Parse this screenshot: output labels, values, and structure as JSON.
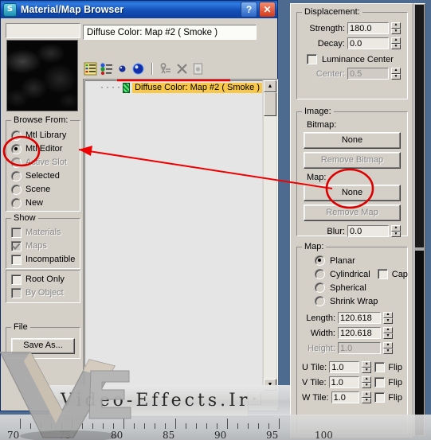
{
  "window": {
    "title": "Material/Map Browser",
    "icon": "app-icon",
    "help_label": "?",
    "close_label": "✕"
  },
  "left": {
    "name_field_value": "",
    "browse_from": {
      "legend": "Browse From:",
      "options": [
        {
          "label": "Mtl Library",
          "selected": false,
          "disabled": false
        },
        {
          "label": "Mtl Editor",
          "selected": true,
          "disabled": false
        },
        {
          "label": "Active Slot",
          "selected": false,
          "disabled": true
        },
        {
          "label": "Selected",
          "selected": false,
          "disabled": false
        },
        {
          "label": "Scene",
          "selected": false,
          "disabled": false
        },
        {
          "label": "New",
          "selected": false,
          "disabled": false
        }
      ]
    },
    "show": {
      "legend": "Show",
      "options": [
        {
          "label": "Materials",
          "checked": false,
          "disabled": true
        },
        {
          "label": "Maps",
          "checked": true,
          "disabled": true
        },
        {
          "label": "Incompatible",
          "checked": false,
          "disabled": false
        }
      ],
      "extra": [
        {
          "label": "Root Only",
          "checked": false,
          "disabled": false
        },
        {
          "label": "By Object",
          "checked": false,
          "disabled": true
        }
      ]
    },
    "file": {
      "legend": "File",
      "save_as_label": "Save As..."
    }
  },
  "header": {
    "path_value": "Diffuse Color: Map #2  ( Smoke )"
  },
  "toolbar": {
    "items": [
      {
        "name": "view-list-icon",
        "enabled": true
      },
      {
        "name": "view-small-icons-icon",
        "enabled": true
      },
      {
        "name": "view-small-sphere-icon",
        "enabled": true
      },
      {
        "name": "view-large-sphere-icon",
        "enabled": true
      },
      {
        "name": "update-scene-materials-icon",
        "enabled": false
      },
      {
        "name": "delete-icon",
        "enabled": false
      },
      {
        "name": "clear-icon",
        "enabled": false
      }
    ]
  },
  "tree": {
    "nodes": [
      {
        "label": "Diffuse Color: Map #2  ( Smoke )",
        "icon": "map-swatch-icon",
        "selected": true
      }
    ]
  },
  "right": {
    "displacement": {
      "legend": "Displacement:",
      "strength_label": "Strength:",
      "strength_value": "180.0",
      "decay_label": "Decay:",
      "decay_value": "0.0",
      "luminance_center_label": "Luminance Center",
      "luminance_center_checked": false,
      "center_label": "Center:",
      "center_value": "0.5",
      "center_disabled": true
    },
    "image": {
      "legend": "Image:",
      "bitmap_label": "Bitmap:",
      "bitmap_button": "None",
      "remove_bitmap_button": "Remove Bitmap",
      "remove_bitmap_disabled": true,
      "map_label": "Map:",
      "map_button": "None",
      "remove_map_button": "Remove Map",
      "remove_map_disabled": true,
      "blur_label": "Blur:",
      "blur_value": "0.0"
    },
    "map": {
      "legend": "Map:",
      "projections": [
        {
          "label": "Planar",
          "selected": true
        },
        {
          "label": "Cylindrical",
          "selected": false
        },
        {
          "label": "Spherical",
          "selected": false
        },
        {
          "label": "Shrink Wrap",
          "selected": false
        }
      ],
      "cap_label": "Cap",
      "cap_checked": false,
      "length_label": "Length:",
      "length_value": "120.618",
      "width_label": "Width:",
      "width_value": "120.618",
      "height_label": "Height:",
      "height_value": "1.0",
      "height_disabled": true,
      "tiles": [
        {
          "label": "U Tile:",
          "value": "1.0",
          "flip_label": "Flip",
          "flip_checked": false
        },
        {
          "label": "V Tile:",
          "value": "1.0",
          "flip_label": "Flip",
          "flip_checked": false
        },
        {
          "label": "W Tile:",
          "value": "1.0",
          "flip_label": "Flip",
          "flip_checked": false
        }
      ]
    }
  },
  "watermark": {
    "text": "Video-Effects.Ir",
    "logo": "ve-logo"
  },
  "ruler": {
    "labels": [
      "70",
      "75",
      "80",
      "85",
      "90",
      "95",
      "100"
    ]
  },
  "colors": {
    "titlebar": "#1350b8",
    "face": "#d4d0c8",
    "highlight": "#f7c84a",
    "annotation": "#e00000"
  }
}
